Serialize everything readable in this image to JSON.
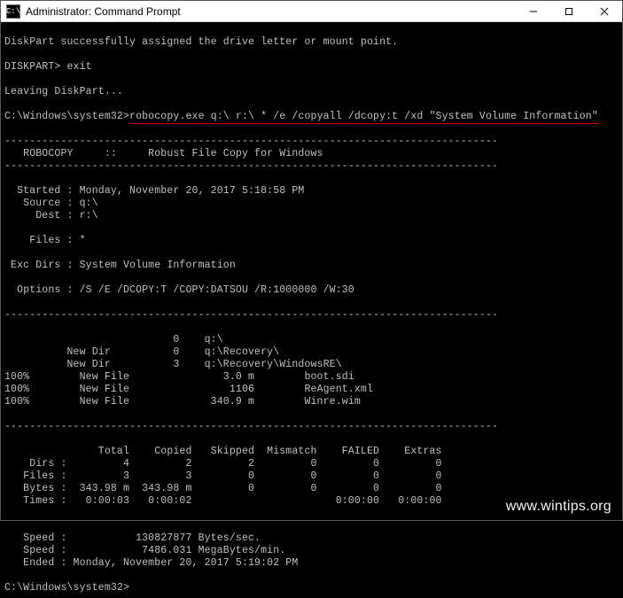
{
  "titlebar": {
    "icon_text": "C:\\",
    "title": "Administrator: Command Prompt"
  },
  "lines": {
    "l0": "DiskPart successfully assigned the drive letter or mount point.",
    "l1": "",
    "l2_prompt": "DISKPART> ",
    "l2_cmd": "exit",
    "l3": "",
    "l4": "Leaving DiskPart...",
    "l5": "",
    "l6_prompt": "C:\\Windows\\system32>",
    "l6_cmd": "robocopy.exe q:\\ r:\\ * /e /copyall /dcopy:t /xd \"System Volume Information\"",
    "l7": "",
    "dash": "-------------------------------------------------------------------------------",
    "l8": "   ROBOCOPY     ::     Robust File Copy for Windows",
    "l9": "",
    "l10": "  Started : Monday, November 20, 2017 5:18:58 PM",
    "l11": "   Source : q:\\",
    "l12": "     Dest : r:\\",
    "l13": "",
    "l14": "    Files : *",
    "l15": "",
    "l16": " Exc Dirs : System Volume Information",
    "l17": "",
    "l18": "  Options : /S /E /DCOPY:T /COPY:DATSOU /R:1000000 /W:30",
    "l19": "",
    "l20": "",
    "l21": "                           0    q:\\",
    "l22": "          New Dir          0    q:\\Recovery\\",
    "l23": "          New Dir          3    q:\\Recovery\\WindowsRE\\",
    "l24": "100%        New File               3.0 m        boot.sdi",
    "l25": "100%        New File                1106        ReAgent.xml",
    "l26": "100%        New File             340.9 m        Winre.wim",
    "l27": "",
    "l28": "",
    "l29": "               Total    Copied   Skipped  Mismatch    FAILED    Extras",
    "l30": "    Dirs :         4         2         2         0         0         0",
    "l31": "   Files :         3         3         0         0         0         0",
    "l32": "   Bytes :  343.98 m  343.98 m         0         0         0         0",
    "l33": "   Times :   0:00:03   0:00:02                       0:00:00   0:00:00",
    "l34": "",
    "l35": "",
    "l36": "   Speed :           130827877 Bytes/sec.",
    "l37": "   Speed :            7486.031 MegaBytes/min.",
    "l38": "   Ended : Monday, November 20, 2017 5:19:02 PM",
    "l39": "",
    "l40_prompt": "C:\\Windows\\system32>"
  },
  "watermark": "www.wintips.org"
}
